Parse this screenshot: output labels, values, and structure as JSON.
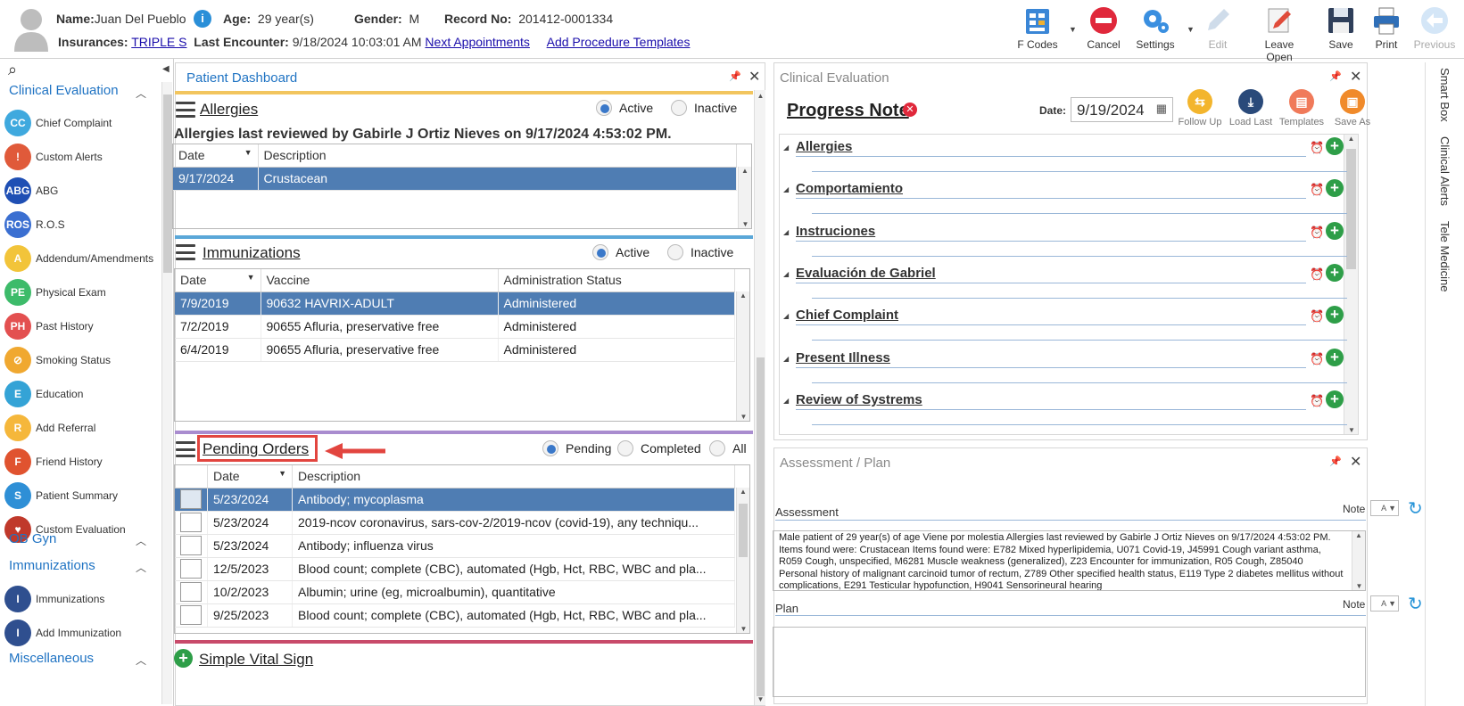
{
  "header": {
    "name_label": "Name:",
    "name": "Juan Del Pueblo",
    "age_label": "Age:",
    "age": "29 year(s)",
    "gender_label": "Gender:",
    "gender": "M",
    "record_label": "Record No:",
    "record": "201412-0001334",
    "ins_label": "Insurances:",
    "insurance": "TRIPLE S",
    "last_enc_label": "Last Encounter:",
    "last_encounter": "9/18/2024 10:03:01 AM",
    "next_appt": "Next Appointments",
    "add_proc": "Add Procedure Templates"
  },
  "toolbar": {
    "fcodes": "F Codes",
    "cancel": "Cancel",
    "settings": "Settings",
    "edit": "Edit",
    "leave_open": "Leave Open",
    "save": "Save",
    "print": "Print",
    "previous": "Previous"
  },
  "nav": {
    "sec1": "Clinical Evaluation",
    "items1": [
      {
        "label": "Chief Complaint",
        "icon": "CC",
        "color": "#3fa9de"
      },
      {
        "label": "Custom Alerts",
        "icon": "!",
        "color": "#e05a3a"
      },
      {
        "label": "ABG",
        "icon": "ABG",
        "color": "#1f4fb4"
      },
      {
        "label": "R.O.S",
        "icon": "ROS",
        "color": "#3b6fd1"
      },
      {
        "label": "Addendum/Amendments",
        "icon": "A",
        "color": "#f2c43a"
      },
      {
        "label": "Physical Exam",
        "icon": "PE",
        "color": "#3dbb6a"
      },
      {
        "label": "Past History",
        "icon": "PH",
        "color": "#e35050"
      },
      {
        "label": "Smoking Status",
        "icon": "⊘",
        "color": "#f0a830"
      },
      {
        "label": "Education",
        "icon": "E",
        "color": "#34a3d6"
      },
      {
        "label": "Add Referral",
        "icon": "R",
        "color": "#f5b73b"
      },
      {
        "label": "Friend History",
        "icon": "F",
        "color": "#e0532f"
      },
      {
        "label": "Patient Summary",
        "icon": "S",
        "color": "#2e8fd6"
      },
      {
        "label": "Custom Evaluation",
        "icon": "♥",
        "color": "#c0392b"
      }
    ],
    "sec2": "OB Gyn",
    "sec3": "Immunizations",
    "items3": [
      {
        "label": "Immunizations",
        "icon": "I",
        "color": "#2f4f8f"
      },
      {
        "label": "Add Immunization",
        "icon": "I",
        "color": "#2f4f8f"
      }
    ],
    "sec4": "Miscellaneous"
  },
  "dashboard": {
    "title": "Patient Dashboard",
    "allergies": {
      "title": "Allergies",
      "active": "Active",
      "inactive": "Inactive",
      "reviewed": "Allergies last reviewed by Gabirle J Ortiz Nieves on 9/17/2024 4:53:02 PM.",
      "cols": [
        "Date",
        "Description"
      ],
      "rows": [
        [
          "9/17/2024",
          "Crustacean"
        ]
      ]
    },
    "immunizations": {
      "title": "Immunizations",
      "active": "Active",
      "inactive": "Inactive",
      "cols": [
        "Date",
        "Vaccine",
        "Administration Status"
      ],
      "rows": [
        [
          "7/9/2019",
          "90632 HAVRIX-ADULT",
          "Administered"
        ],
        [
          "7/2/2019",
          "90655 Afluria, preservative free",
          "Administered"
        ],
        [
          "6/4/2019",
          "90655 Afluria, preservative free",
          "Administered"
        ]
      ]
    },
    "orders": {
      "title": "Pending Orders",
      "pending": "Pending",
      "completed": "Completed",
      "all": "All",
      "cols": [
        "Date",
        "Description"
      ],
      "rows": [
        [
          "5/23/2024",
          "Antibody; mycoplasma"
        ],
        [
          "5/23/2024",
          "2019-ncov coronavirus, sars-cov-2/2019-ncov (covid-19), any techniqu..."
        ],
        [
          "5/23/2024",
          "Antibody; influenza virus"
        ],
        [
          "12/5/2023",
          "Blood count; complete (CBC), automated (Hgb, Hct, RBC, WBC and pla..."
        ],
        [
          "10/2/2023",
          "Albumin; urine (eg, microalbumin), quantitative"
        ],
        [
          "9/25/2023",
          "Blood count; complete (CBC), automated (Hgb, Hct, RBC, WBC and pla..."
        ]
      ]
    },
    "vital": "Simple Vital Sign"
  },
  "clinical": {
    "title": "Clinical Evaluation",
    "note": "Progress Note",
    "date_label": "Date:",
    "date": "9/19/2024",
    "tools": [
      {
        "label": "Follow Up",
        "color": "#f3b52d"
      },
      {
        "label": "Load Last",
        "color": "#2a4a7a"
      },
      {
        "label": "Templates",
        "color": "#f07a5a"
      },
      {
        "label": "Save As",
        "color": "#f08a2a"
      }
    ],
    "sections": [
      "Allergies",
      "Comportamiento",
      "Instruciones",
      "Evaluación de Gabriel",
      "Chief Complaint",
      "Present Illness",
      "Review of Systrems"
    ]
  },
  "assessment": {
    "title": "Assessment / Plan",
    "assessment_label": "Assessment",
    "note_label": "Note",
    "plan_label": "Plan",
    "text": "Male patient of 29 year(s) of age Viene por molestia     Allergies last reviewed by Gabirle J Ortiz Nieves on 9/17/2024 4:53:02 PM.    Items found were:  Crustacean  Items found were:  E782 Mixed hyperlipidemia, U071 Covid-19, J45991 Cough variant asthma, R059 Cough, unspecified, M6281 Muscle weakness (generalized), Z23 Encounter for immunization, R05 Cough, Z85040 Personal history of malignant carcinoid tumor of rectum, Z789 Other specified health status, E119 Type 2 diabetes mellitus without complications, E291 Testicular hypofunction, H9041 Sensorineural hearing"
  },
  "sidetabs": [
    "Smart Box",
    "Clinical Alerts",
    "Tele Medicine"
  ]
}
